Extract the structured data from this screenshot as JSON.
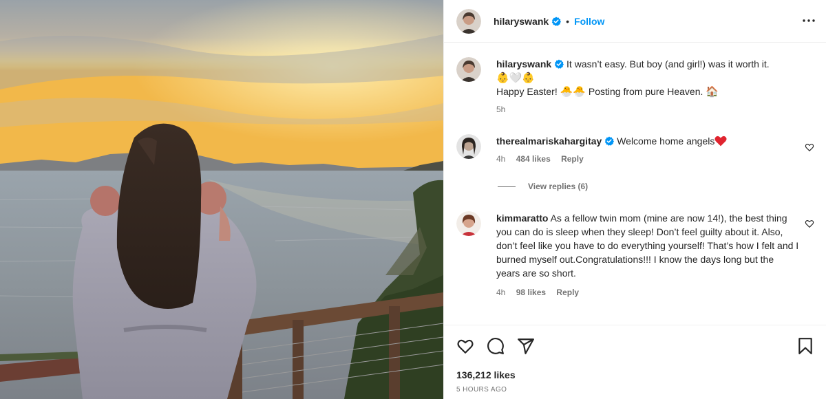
{
  "post": {
    "author": "hilaryswank",
    "follow_label": "Follow",
    "separator": "•"
  },
  "caption": {
    "username": "hilaryswank",
    "line1": "It wasn’t easy. But boy (and girl!) was it worth it.",
    "emoji_line": "👶🤍👶",
    "line3_a": "Happy Easter! ",
    "line3_emoji": "🐣🐣",
    "line3_b": " Posting from pure Heaven. ",
    "line3_emoji_end": "🏠",
    "time": "5h"
  },
  "comments": [
    {
      "username": "therealmariskahargitay",
      "text": "Welcome home angels",
      "text_emoji": "❤️",
      "time": "4h",
      "likes": "484 likes",
      "reply": "Reply"
    },
    {
      "username": "kimmaratto",
      "text": "As a fellow twin mom (mine are now 14!), the best thing you can do is sleep when they sleep! Don’t feel guilty about it. Also, don’t feel like you have to do everything yourself! That’s how I felt and I burned myself out.Congratulations!!! I know the days long but the years are so short.",
      "time": "4h",
      "likes": "98 likes",
      "reply": "Reply"
    }
  ],
  "view_replies": "View replies (6)",
  "footer": {
    "likes": "136,212 likes",
    "time_ago": "5 HOURS AGO"
  },
  "icons": {
    "like": "heart-icon",
    "comment": "comment-icon",
    "share": "share-icon",
    "save": "bookmark-icon",
    "more": "more-icon",
    "verified": "verified-badge-icon"
  },
  "colors": {
    "link": "#0095f6",
    "verified": "#0095f6",
    "heart": "#ed4956",
    "muted": "#737373"
  }
}
